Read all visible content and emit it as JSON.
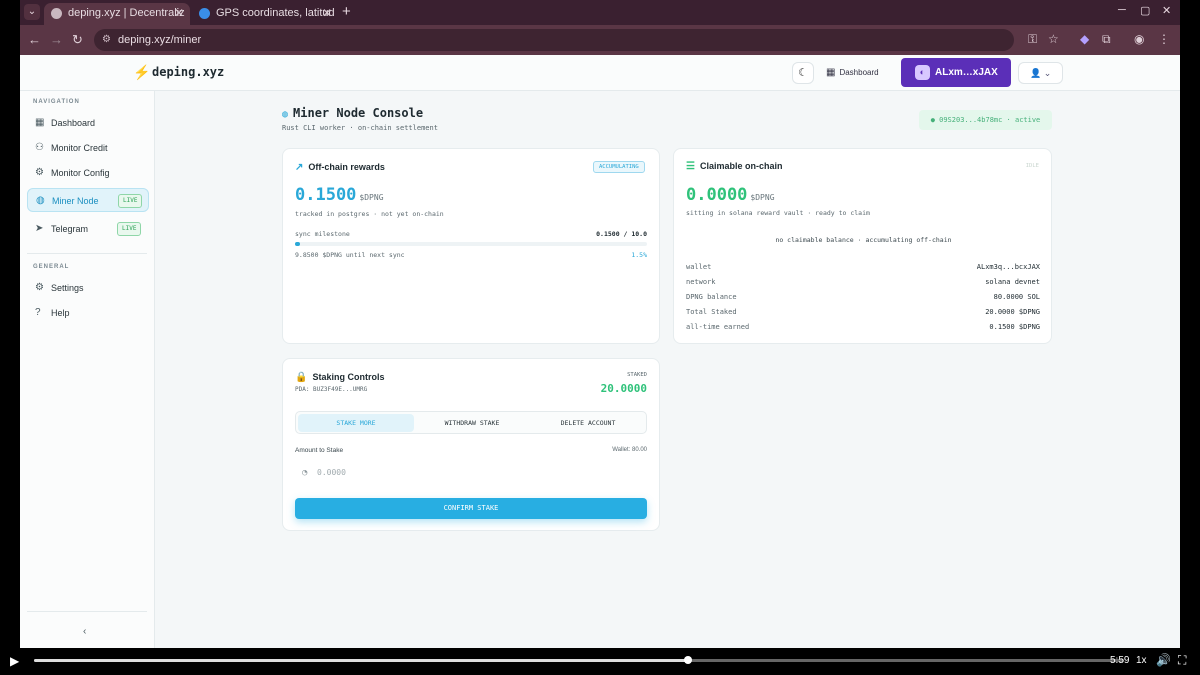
{
  "browser": {
    "tabs": [
      {
        "title": "deping.xyz | Decentraliz",
        "active": true
      },
      {
        "title": "GPS coordinates, latitud",
        "active": false
      }
    ],
    "url": "deping.xyz/miner"
  },
  "header": {
    "logo": "deping.xyz",
    "dashboard_label": "Dashboard",
    "wallet_label": "ALxm…xJAX"
  },
  "sidebar": {
    "navigation_label": "NAVIGATION",
    "items": [
      {
        "label": "Dashboard",
        "icon": "grid-icon"
      },
      {
        "label": "Monitor Credit",
        "icon": "user-icon"
      },
      {
        "label": "Monitor Config",
        "icon": "gear-icon"
      },
      {
        "label": "Miner Node",
        "icon": "globe-icon",
        "badge": "LIVE",
        "active": true
      },
      {
        "label": "Telegram",
        "icon": "send-icon",
        "badge": "LIVE"
      }
    ],
    "general_label": "GENERAL",
    "general_items": [
      {
        "label": "Settings",
        "icon": "gear-icon"
      },
      {
        "label": "Help",
        "icon": "help-icon"
      }
    ]
  },
  "page": {
    "title": "Miner Node Console",
    "subtitle": "Rust CLI worker · on-chain settlement",
    "status": "● 09S203...4b78mc · active"
  },
  "offchain": {
    "title": "Off-chain rewards",
    "badge": "ACCUMULATING",
    "value": "0.1500",
    "unit": "$DPNG",
    "caption": "tracked in postgres · not yet on-chain",
    "milestone_label": "sync milestone",
    "milestone_value": "0.1500 / 10.0",
    "progress_fraction": 0.015,
    "remaining": "9.8500 $DPNG until next sync",
    "percent": "1.5%"
  },
  "claimable": {
    "title": "Claimable on-chain",
    "badge": "IDLE",
    "value": "0.0000",
    "unit": "$DPNG",
    "caption": "sitting in solana reward vault · ready to claim",
    "empty_note": "no claimable balance · accumulating off-chain",
    "rows": [
      {
        "k": "wallet",
        "v": "ALxm3q...bcxJAX"
      },
      {
        "k": "network",
        "v": "solana devnet"
      },
      {
        "k": "DPNG balance",
        "v": "80.0000 SOL"
      },
      {
        "k": "Total Staked",
        "v": "20.0000 $DPNG"
      },
      {
        "k": "all-time earned",
        "v": "0.1500 $DPNG"
      }
    ]
  },
  "staking": {
    "title": "Staking Controls",
    "pda": "PDA: BUZ3F49E...UMRG",
    "staked_label": "STAKED",
    "staked_value": "20.0000",
    "tabs": [
      "STAKE MORE",
      "WITHDRAW STAKE",
      "DELETE ACCOUNT"
    ],
    "amount_label": "Amount to Stake",
    "wallet_balance": "Wallet: 80.00",
    "amount_placeholder": "0.0000",
    "confirm_label": "CONFIRM STAKE"
  },
  "video": {
    "time": "5:59",
    "speed": "1x",
    "progress_fraction": 0.6
  },
  "colors": {
    "accent": "#2aa8d8",
    "wallet": "#5b2fb8",
    "green": "#2fc27a"
  }
}
